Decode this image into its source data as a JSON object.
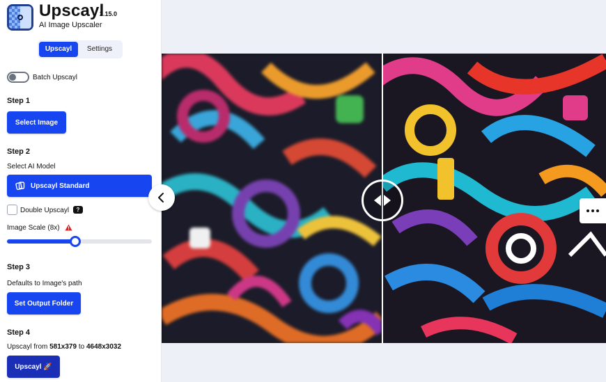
{
  "app": {
    "title": "Upscayl",
    "version": "2.15.0",
    "subtitle": "AI Image Upscaler"
  },
  "tabs": [
    {
      "label": "Upscayl",
      "active": true
    },
    {
      "label": "Settings",
      "active": false
    }
  ],
  "batch": {
    "label": "Batch Upscayl",
    "enabled": false
  },
  "step1": {
    "title": "Step 1",
    "button": "Select Image"
  },
  "step2": {
    "title": "Step 2",
    "model_label": "Select AI Model",
    "model_button": "Upscayl Standard",
    "double_label": "Double Upscayl",
    "double_checked": false,
    "help_badge": "?",
    "scale_label": "Image Scale (8x)",
    "scale_fraction": 0.47
  },
  "step3": {
    "title": "Step 3",
    "path_label": "Defaults to Image's path",
    "button": "Set Output Folder"
  },
  "step4": {
    "title": "Step 4",
    "from_prefix": "Upscayl from ",
    "from_size": "581x379",
    "to_word": " to ",
    "to_size": "4648x3032",
    "button": "Upscayl 🚀"
  },
  "preview": {
    "split_fraction": 0.497
  },
  "colors": {
    "accent": "#1746f0",
    "upscayl_button": "#1a2fb5",
    "warning": "#dc2626"
  },
  "icons": {
    "collapse": "chevron-left-icon",
    "more": "more-horizontal-icon",
    "divider": "compare-arrows-icon",
    "model": "model-icon",
    "warning": "warning-triangle-icon"
  }
}
